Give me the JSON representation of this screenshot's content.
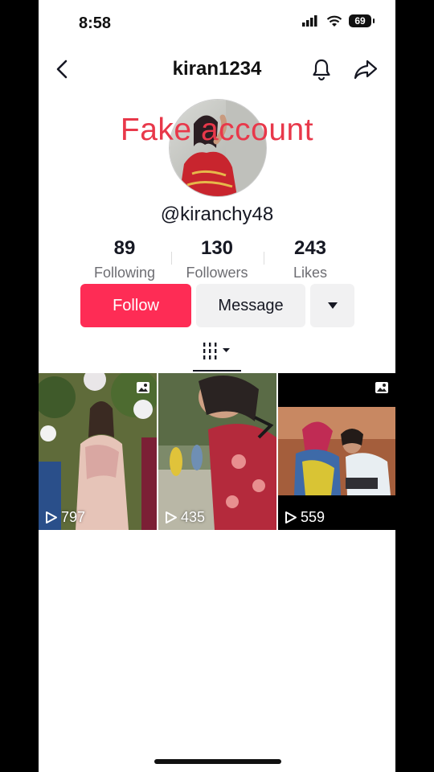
{
  "status_bar": {
    "time": "8:58",
    "battery": "69"
  },
  "header": {
    "title": "kiran1234"
  },
  "overlay_text": "Fake account",
  "profile": {
    "username": "@kiranchy48"
  },
  "stats": [
    {
      "value": "89",
      "label": "Following"
    },
    {
      "value": "130",
      "label": "Followers"
    },
    {
      "value": "243",
      "label": "Likes"
    }
  ],
  "actions": {
    "follow_label": "Follow",
    "message_label": "Message"
  },
  "videos": [
    {
      "views": "797",
      "photo_post": true
    },
    {
      "views": "435",
      "photo_post": false
    },
    {
      "views": "559",
      "photo_post": true
    }
  ],
  "colors": {
    "accent": "#fe2c55",
    "overlay": "#e8384a"
  }
}
